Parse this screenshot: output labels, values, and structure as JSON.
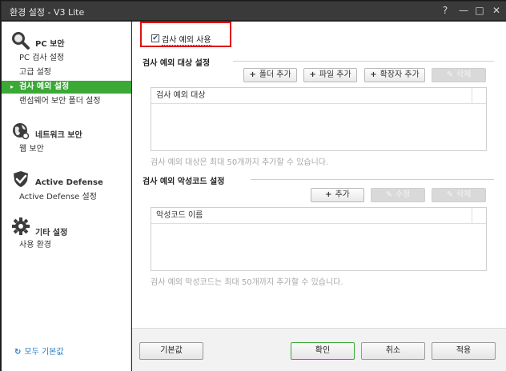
{
  "window": {
    "title": "환경 설정 - V3 Lite"
  },
  "titlebar_buttons": {
    "help": "?",
    "minimize": "—",
    "maximize": "□",
    "close": "✕"
  },
  "sidebar": {
    "groups": [
      {
        "title": "PC 보안",
        "icon": "magnifier-icon",
        "items": [
          "PC 검사 설정",
          "고급 설정",
          "검사 예외 설정",
          "랜섬웨어 보안 폴더 설정"
        ]
      },
      {
        "title": "네트워크 보안",
        "icon": "globe-icon",
        "items": [
          "웹 보안"
        ]
      },
      {
        "title": "Active Defense",
        "icon": "shield-check-icon",
        "items": [
          "Active Defense 설정"
        ]
      },
      {
        "title": "기타 설정",
        "icon": "gear-icon",
        "items": [
          "사용 환경"
        ]
      }
    ],
    "active_item": "검사 예외 설정",
    "reset_all": "모두 기본값"
  },
  "main": {
    "use_exception": {
      "label": "검사 예외 사용",
      "checked": true
    },
    "exclusion_section": {
      "title": "검사 예외 대상 설정",
      "buttons": {
        "add_folder": "폴더 추가",
        "add_file": "파일 추가",
        "add_extension": "확장자 추가",
        "delete": "삭제"
      },
      "column": "검사 예외 대상",
      "hint": "검사 예외 대상은 최대 50개까지 추가할 수 있습니다."
    },
    "malware_section": {
      "title": "검사 예외 악성코드 설정",
      "buttons": {
        "add": "추가",
        "edit": "수정",
        "delete": "삭제"
      },
      "column": "악성코드 이름",
      "hint": "검사 예외 악성코드는 최대 50개까지 추가할 수 있습니다."
    }
  },
  "footer": {
    "default": "기본값",
    "ok": "확인",
    "cancel": "취소",
    "apply": "적용"
  },
  "colors": {
    "accent": "#3aa936",
    "highlight_box": "#e01010",
    "link": "#2a7fc4"
  }
}
